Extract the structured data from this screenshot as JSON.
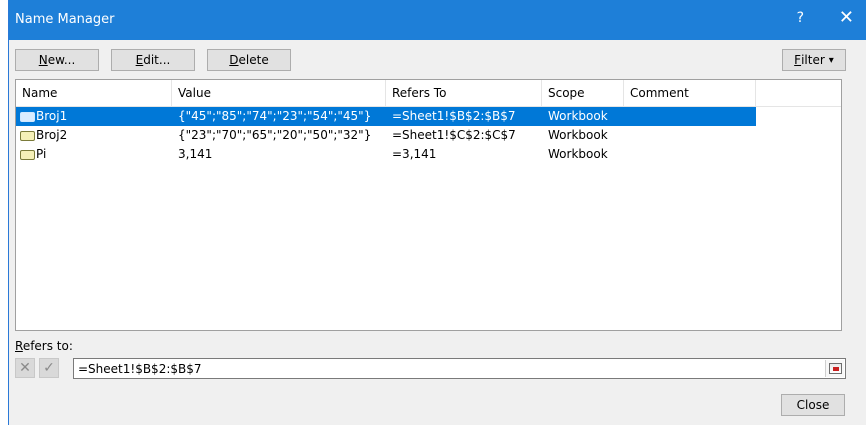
{
  "window": {
    "title": "Name Manager",
    "help": "?",
    "close": "✕"
  },
  "toolbar": {
    "new_pre": "",
    "new_ul": "N",
    "new_post": "ew...",
    "edit_pre": "",
    "edit_ul": "E",
    "edit_post": "dit...",
    "delete_pre": "",
    "delete_ul": "D",
    "delete_post": "elete",
    "filter_pre": "",
    "filter_ul": "F",
    "filter_post": "ilter",
    "filter_arrow": "▾"
  },
  "table": {
    "headers": {
      "name": "Name",
      "value": "Value",
      "refers_to": "Refers To",
      "scope": "Scope",
      "comment": "Comment"
    },
    "rows": [
      {
        "name": "Broj1",
        "value": "{\"45\";\"85\";\"74\";\"23\";\"54\";\"45\"}",
        "refers_to": "=Sheet1!$B$2:$B$7",
        "scope": "Workbook",
        "comment": ""
      },
      {
        "name": "Broj2",
        "value": "{\"23\";\"70\";\"65\";\"20\";\"50\";\"32\"}",
        "refers_to": "=Sheet1!$C$2:$C$7",
        "scope": "Workbook",
        "comment": ""
      },
      {
        "name": "Pi",
        "value": "3,141",
        "refers_to": "=3,141",
        "scope": "Workbook",
        "comment": ""
      }
    ]
  },
  "refers": {
    "label_ul": "R",
    "label_post": "efers to:",
    "value": "=Sheet1!$B$2:$B$7",
    "cancel_glyph": "✕",
    "confirm_glyph": "✓"
  },
  "footer": {
    "close_label": "Close"
  },
  "colors": {
    "titlebar": "#1e7fd8",
    "selection": "#0078d7"
  }
}
